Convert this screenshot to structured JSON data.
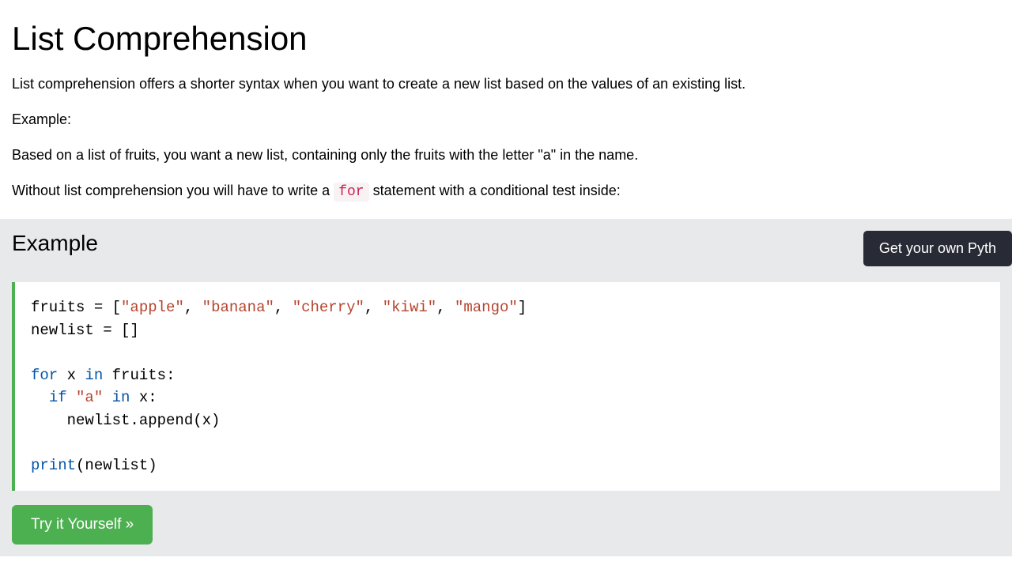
{
  "heading": "List Comprehension",
  "intro": "List comprehension offers a shorter syntax when you want to create a new list based on the values of an existing list.",
  "example_label": "Example:",
  "based_on": "Based on a list of fruits, you want a new list, containing only the fruits with the letter \"a\" in the name.",
  "without_pre": "Without list comprehension you will have to write a ",
  "without_code": "for",
  "without_post": " statement with a conditional test inside:",
  "example_heading": "Example",
  "get_server_btn": "Get your own Pyth",
  "try_btn": "Try it Yourself »",
  "code": {
    "l1a": "fruits = [",
    "l1s1": "\"apple\"",
    "l1c1": ", ",
    "l1s2": "\"banana\"",
    "l1c2": ", ",
    "l1s3": "\"cherry\"",
    "l1c3": ", ",
    "l1s4": "\"kiwi\"",
    "l1c4": ", ",
    "l1s5": "\"mango\"",
    "l1b": "]",
    "l2": "newlist = []",
    "l3": "",
    "l4a": "for",
    "l4b": " x ",
    "l4c": "in",
    "l4d": " fruits:",
    "l5a": "  ",
    "l5b": "if",
    "l5c": " ",
    "l5d": "\"a\"",
    "l5e": " ",
    "l5f": "in",
    "l5g": " x:",
    "l6": "    newlist.append(x)",
    "l7": "",
    "l8a": "print",
    "l8b": "(newlist)"
  }
}
